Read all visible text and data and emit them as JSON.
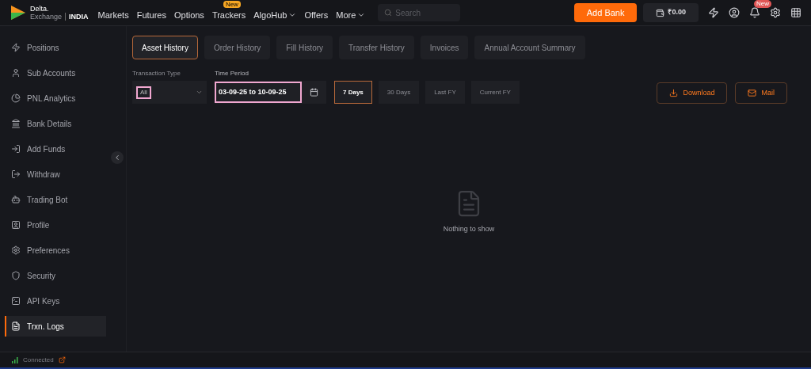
{
  "header": {
    "logo": {
      "line1": "Delta.",
      "line2": "Exchange",
      "region": "INDIA"
    },
    "nav": [
      {
        "label": "Markets",
        "has_menu": false
      },
      {
        "label": "Futures",
        "has_menu": false
      },
      {
        "label": "Options",
        "has_menu": false
      },
      {
        "label": "Trackers",
        "has_menu": false,
        "badge": "New"
      },
      {
        "label": "AlgoHub",
        "has_menu": true
      },
      {
        "label": "Offers",
        "has_menu": false
      },
      {
        "label": "More",
        "has_menu": true
      }
    ],
    "search": {
      "placeholder": "Search"
    },
    "add_bank_button": "Add Bank",
    "wallet_balance": "₹0.00",
    "notification_badge": "New"
  },
  "sidebar": {
    "items": [
      {
        "label": "Positions",
        "selected": false
      },
      {
        "label": "Sub Accounts",
        "selected": false
      },
      {
        "label": "PNL Analytics",
        "selected": false
      },
      {
        "label": "Bank Details",
        "selected": false
      },
      {
        "label": "Add Funds",
        "selected": false
      },
      {
        "label": "Withdraw",
        "selected": false
      },
      {
        "label": "Trading Bot",
        "selected": false
      },
      {
        "label": "Profile",
        "selected": false
      },
      {
        "label": "Preferences",
        "selected": false
      },
      {
        "label": "Security",
        "selected": false
      },
      {
        "label": "API Keys",
        "selected": false
      },
      {
        "label": "Trxn. Logs",
        "selected": true
      }
    ],
    "status": "Connected"
  },
  "tabs": [
    {
      "label": "Asset History",
      "selected": true
    },
    {
      "label": "Order History",
      "selected": false
    },
    {
      "label": "Fill History",
      "selected": false
    },
    {
      "label": "Transfer History",
      "selected": false
    },
    {
      "label": "Invoices",
      "selected": false
    },
    {
      "label": "Annual Account Summary",
      "selected": false
    }
  ],
  "filters": {
    "transaction_type": {
      "label": "Transaction Type",
      "value": "All",
      "highlighted": true
    },
    "time_period": {
      "label": "Time Period",
      "value": "03-09-25 to 10-09-25",
      "highlighted": true
    },
    "presets": [
      {
        "label": "7 Days",
        "selected": true
      },
      {
        "label": "30 Days",
        "selected": false
      },
      {
        "label": "Last FY",
        "selected": false
      },
      {
        "label": "Current FY",
        "selected": false
      }
    ]
  },
  "actions": [
    "Download",
    "Mail"
  ],
  "empty_state": "Nothing to show"
}
